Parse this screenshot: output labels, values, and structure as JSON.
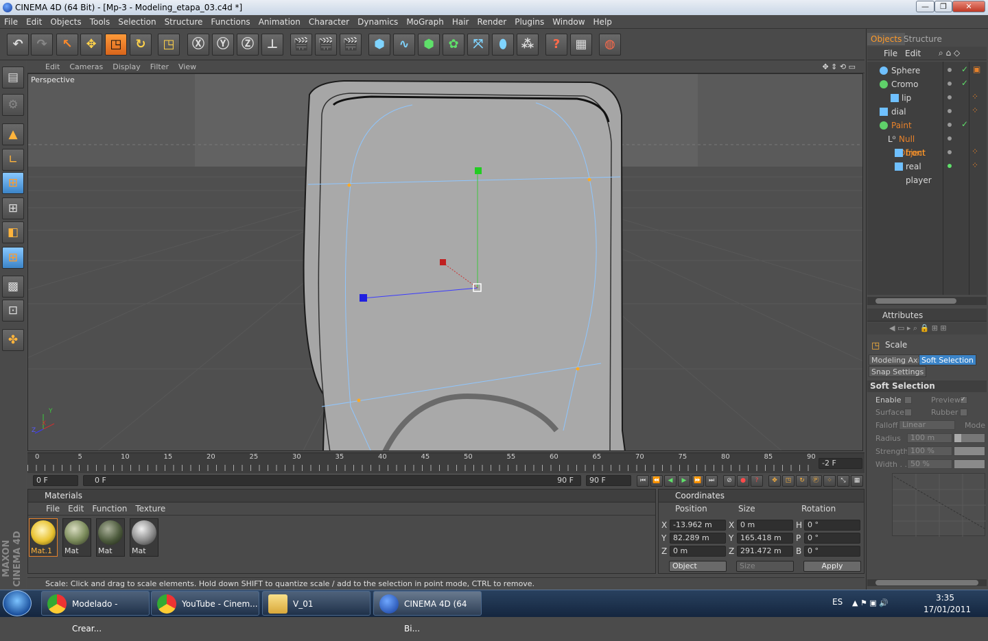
{
  "window": {
    "title": "CINEMA 4D (64 Bit) - [Mp-3 - Modeling_etapa_03.c4d *]",
    "minimize": "—",
    "maximize": "❐",
    "close": "✕"
  },
  "menu": [
    "File",
    "Edit",
    "Objects",
    "Tools",
    "Selection",
    "Structure",
    "Functions",
    "Animation",
    "Character",
    "Dynamics",
    "MoGraph",
    "Hair",
    "Render",
    "Plugins",
    "Window",
    "Help"
  ],
  "viewport": {
    "menu": [
      "Edit",
      "Cameras",
      "Display",
      "Filter",
      "View"
    ],
    "label": "Perspective",
    "axis_x": "X",
    "axis_y": "Y",
    "axis_z": "Z"
  },
  "timeline": {
    "ticks": [
      "0",
      "5",
      "10",
      "15",
      "20",
      "25",
      "30",
      "35",
      "40",
      "45",
      "50",
      "55",
      "60",
      "65",
      "70",
      "75",
      "80",
      "85",
      "90"
    ],
    "end_field": "-2 F",
    "current_frame": "0 F",
    "range_start": "0 F",
    "range_end": "90 F",
    "max_frame": "90 F"
  },
  "materials": {
    "title": "Materials",
    "menu": [
      "File",
      "Edit",
      "Function",
      "Texture"
    ],
    "items": [
      {
        "label": "Mat.1",
        "color": "#f0d040"
      },
      {
        "label": "Mat",
        "color": "#8a9a6a"
      },
      {
        "label": "Mat",
        "color": "#4c5a3c"
      },
      {
        "label": "Mat",
        "color": "#9a9a9a"
      }
    ]
  },
  "coordinates": {
    "title": "Coordinates",
    "headers": {
      "position": "Position",
      "size": "Size",
      "rotation": "Rotation"
    },
    "rows": [
      {
        "axis": "X",
        "pos": "-13.962 m",
        "saxis": "X",
        "size": "0 m",
        "raxis": "H",
        "rot": "0 °"
      },
      {
        "axis": "Y",
        "pos": "82.289 m",
        "saxis": "Y",
        "size": "165.418 m",
        "raxis": "P",
        "rot": "0 °"
      },
      {
        "axis": "Z",
        "pos": "0 m",
        "saxis": "Z",
        "size": "291.472 m",
        "raxis": "B",
        "rot": "0 °"
      }
    ],
    "mode_select": "Object",
    "size_select": "Size",
    "apply": "Apply"
  },
  "status": "Scale: Click and drag to scale elements. Hold down SHIFT to quantize scale / add to the selection in point mode, CTRL to remove.",
  "objects_panel": {
    "tabs": [
      "Objects",
      "Structure"
    ],
    "menu": [
      "File",
      "Edit"
    ],
    "items": [
      {
        "name": "Sphere",
        "indent": 0,
        "color": "#6fc0ff"
      },
      {
        "name": "Cromo",
        "indent": 0,
        "color": "#5fd06a"
      },
      {
        "name": "lip",
        "indent": 1,
        "color": "#6fc0ff"
      },
      {
        "name": "dial",
        "indent": 0,
        "color": "#6fc0ff"
      },
      {
        "name": "Paint",
        "indent": 0,
        "color": "#5fd06a"
      },
      {
        "name": "Null Object",
        "indent": 1,
        "color": "#e08a2a"
      },
      {
        "name": "front",
        "indent": 2,
        "color": "#6fc0ff"
      },
      {
        "name": "real player",
        "indent": 2,
        "color": "#6fc0ff"
      }
    ]
  },
  "attributes": {
    "title": "Attributes",
    "tool": "Scale",
    "tabs": [
      "Modeling Axis",
      "Soft Selection",
      "Snap Settings"
    ],
    "section": "Soft Selection",
    "enable": "Enable",
    "preview": "Preview",
    "preview_check": "✓",
    "surface": "Surface",
    "rubber": "Rubber",
    "falloff": "Falloff",
    "falloff_value": "Linear",
    "mode": "Mode",
    "radius": "Radius",
    "radius_value": "100 m",
    "strength": "Strength",
    "strength_value": "100 %",
    "width": "Width . .",
    "width_value": "50 %"
  },
  "taskbar": {
    "tasks": [
      "Modelado - Crear...",
      "YouTube - Cinem...",
      "V_01",
      "CINEMA 4D (64 Bi..."
    ],
    "lang": "ES",
    "time": "3:35",
    "date": "17/01/2011"
  },
  "colors": {
    "accent_orange": "#e8822a",
    "selection_blue": "#3b84c8",
    "viewport_bg": "#5e5e5e"
  }
}
